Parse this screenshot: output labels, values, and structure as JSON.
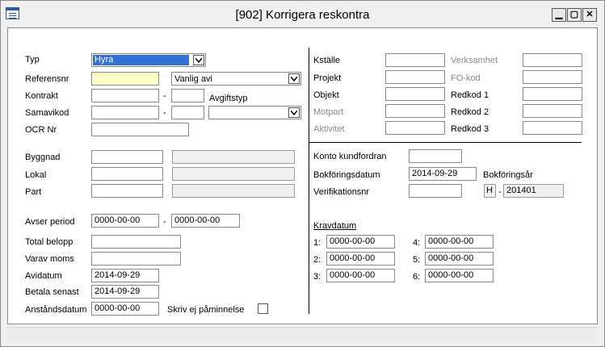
{
  "window": {
    "title": "[902]  Korrigera reskontra",
    "min_glyph": "▁",
    "max_glyph": "▢",
    "close_glyph": "✕"
  },
  "left": {
    "typ_label": "Typ",
    "typ_value": "Hyra",
    "referensnr_label": "Referensnr",
    "referensnr_value": "",
    "avi_type_value": "Vanlig avi",
    "kontrakt_label": "Kontrakt",
    "dash": "-",
    "avgiftstyp_label": "Avgiftstyp",
    "samavikod_label": "Samavikod",
    "ocr_label": "OCR Nr",
    "byggnad_label": "Byggnad",
    "lokal_label": "Lokal",
    "part_label": "Part",
    "avser_period_label": "Avser period",
    "avser_from": "0000-00-00",
    "avser_to": "0000-00-00",
    "total_belopp_label": "Total belopp",
    "varav_moms_label": "Varav moms",
    "avidatum_label": "Avidatum",
    "avidatum_value": "2014-09-29",
    "betala_senast_label": "Betala senast",
    "betala_senast_value": "2014-09-29",
    "anstandsdatum_label": "Anståndsdatum",
    "anstandsdatum_value": "0000-00-00",
    "skriv_ej_label": "Skriv ej påminnelse"
  },
  "right": {
    "kstalle_label": "Kställe",
    "verksamhet_label": "Verksamhet",
    "projekt_label": "Projekt",
    "fokod_label": "FO-kod",
    "objekt_label": "Objekt",
    "redkod1_label": "Redkod 1",
    "motpart_label": "Motpart",
    "redkod2_label": "Redkod 2",
    "aktivitet_label": "Aktivitet",
    "redkod3_label": "Redkod 3",
    "konto_label": "Konto kundfordran",
    "bokforingsdatum_label": "Bokföringsdatum",
    "bokforingsdatum_value": "2014-09-29",
    "bokforingsar_label": "Bokföringsår",
    "verifikationsnr_label": "Verifikationsnr",
    "bokforingsar_prefix": "H",
    "bokforingsar_dash": "-",
    "bokforingsar_value": "201401",
    "kravdatum_label": "Kravdatum",
    "krav": [
      {
        "label": "1:",
        "value": "0000-00-00"
      },
      {
        "label": "2:",
        "value": "0000-00-00"
      },
      {
        "label": "3:",
        "value": "0000-00-00"
      },
      {
        "label": "4:",
        "value": "0000-00-00"
      },
      {
        "label": "5:",
        "value": "0000-00-00"
      },
      {
        "label": "6:",
        "value": "0000-00-00"
      }
    ]
  }
}
